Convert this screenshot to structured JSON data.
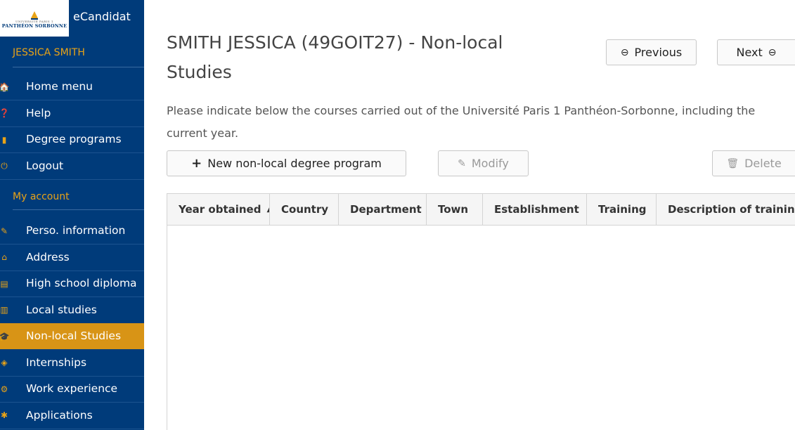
{
  "app": {
    "name": "eCandidat",
    "logo_small": "UNIVERSITÉ PARIS 1",
    "logo_big": "PANTHÉON SORBONNE"
  },
  "sidebar": {
    "user": "JESSICA SMITH",
    "items": [
      {
        "label": "Home menu",
        "icon": "home-icon",
        "glyph": "🏠"
      },
      {
        "label": "Help",
        "icon": "help-icon",
        "glyph": "❓"
      },
      {
        "label": "Degree programs",
        "icon": "bookmark-icon",
        "glyph": "▮"
      },
      {
        "label": "Logout",
        "icon": "power-icon",
        "glyph": "⏻"
      }
    ],
    "account_title": "My account",
    "account_items": [
      {
        "label": "Perso. information",
        "icon": "pencil-icon",
        "glyph": "✎"
      },
      {
        "label": "Address",
        "icon": "home-icon",
        "glyph": "⌂"
      },
      {
        "label": "High school diploma",
        "icon": "book-icon",
        "glyph": "▤"
      },
      {
        "label": "Local studies",
        "icon": "institution-icon",
        "glyph": "▥"
      },
      {
        "label": "Non-local Studies",
        "icon": "graduation-cap-icon",
        "glyph": "🎓",
        "active": true
      },
      {
        "label": "Internships",
        "icon": "cube-icon",
        "glyph": "◈"
      },
      {
        "label": "Work experience",
        "icon": "cogs-icon",
        "glyph": "⚙"
      },
      {
        "label": "Applications",
        "icon": "puzzle-icon",
        "glyph": "✱"
      }
    ]
  },
  "main": {
    "title": "SMITH JESSICA (49GOIT27) - Non-local Studies",
    "intro": "Please indicate below the courses carried out of the Université Paris 1 Panthéon-Sorbonne, including the current year.",
    "buttons": {
      "previous": "Previous",
      "next": "Next",
      "new": "New non-local degree program",
      "modify": "Modify",
      "delete": "Delete"
    },
    "table": {
      "columns": [
        "Year obtained",
        "Country",
        "Department",
        "Town",
        "Establishment",
        "Training",
        "Description of training"
      ],
      "sorted_column": "Year obtained",
      "sort_direction": "ascending",
      "rows": []
    }
  },
  "colors": {
    "sidebar": "#003b7a",
    "accent": "#e8a317",
    "active": "#d89416"
  }
}
